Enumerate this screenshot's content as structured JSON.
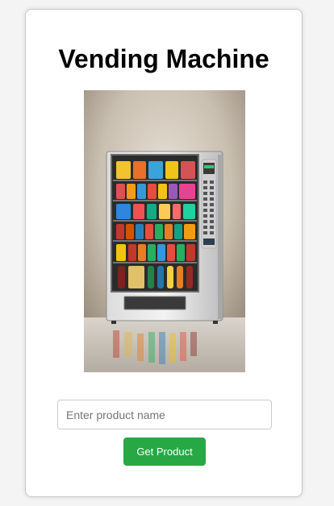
{
  "page": {
    "title": "Vending Machine"
  },
  "image": {
    "alt": "vending-machine-illustration"
  },
  "form": {
    "input_placeholder": "Enter product name",
    "input_value": "",
    "button_label": "Get Product"
  },
  "colors": {
    "button_bg": "#28a745",
    "button_text": "#ffffff",
    "card_bg": "#ffffff",
    "page_bg": "#f4f4f4"
  }
}
